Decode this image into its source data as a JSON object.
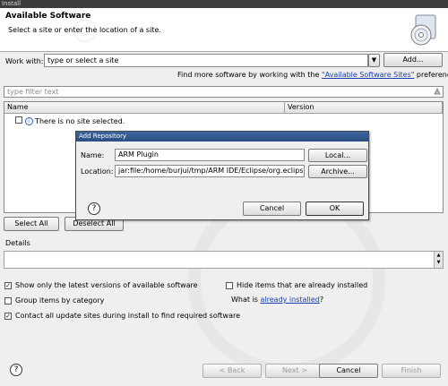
{
  "window": {
    "title": "Install"
  },
  "header": {
    "title": "Available Software",
    "subtitle": "Select a site or enter the location of a site.",
    "icon": "install-cd-icon"
  },
  "work_with": {
    "label": "Work with:",
    "placeholder": "type or select a site",
    "add_button": "Add...",
    "hint_prefix": "Find more software by working with the ",
    "hint_link": "\"Available Software Sites\"",
    "hint_suffix": " preferences."
  },
  "filter": {
    "placeholder": "type filter text"
  },
  "table": {
    "columns": [
      "Name",
      "Version"
    ],
    "rows": [
      {
        "name": "There is no site selected.",
        "version": ""
      }
    ]
  },
  "selection_buttons": {
    "select_all": "Select All",
    "deselect_all": "Deselect All"
  },
  "details": {
    "label": "Details"
  },
  "options": {
    "show_latest": "Show only the latest versions of available software",
    "group_by_category": "Group items by category",
    "contact_sites": "Contact all update sites during install to find required software",
    "hide_installed": "Hide items that are already installed",
    "what_is": "What is ",
    "already_installed_link": "already installed",
    "what_is_suffix": "?"
  },
  "checks": {
    "show_latest": true,
    "group_by_category": false,
    "contact_sites": true,
    "hide_installed": false
  },
  "dialog": {
    "title": "Add Repository",
    "name_label": "Name:",
    "name_value": "ARM Plugin",
    "location_label": "Location:",
    "location_value": "jar:file:/home/burjui/tmp/ARM IDE/Eclipse/org.eclipse.cdt",
    "local_button": "Local...",
    "archive_button": "Archive...",
    "cancel_button": "Cancel",
    "ok_button": "OK"
  },
  "footer": {
    "back_button": "< Back",
    "next_button": "Next >",
    "cancel_button": "Cancel",
    "finish_button": "Finish"
  }
}
